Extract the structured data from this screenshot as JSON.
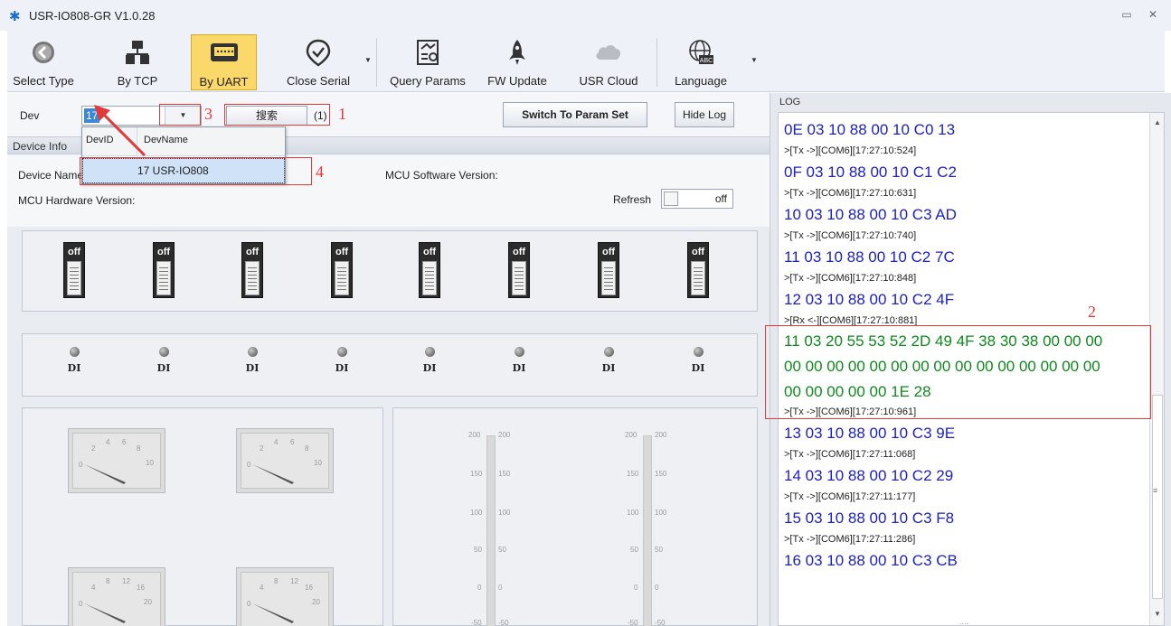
{
  "window": {
    "title": "USR-IO808-GR V1.0.28",
    "minimize": "▭",
    "close": "✕"
  },
  "toolbar": {
    "buttons": [
      {
        "label": "Select Type",
        "icon": "back-arrow-icon"
      },
      {
        "label": "By TCP",
        "icon": "network-icon"
      },
      {
        "label": "By UART",
        "icon": "serial-port-icon",
        "active": true
      },
      {
        "label": "Close Serial",
        "icon": "check-circle-icon"
      },
      {
        "label": "Query Params",
        "icon": "query-document-icon"
      },
      {
        "label": "FW Update",
        "icon": "rocket-icon"
      },
      {
        "label": "USR Cloud",
        "icon": "cloud-icon"
      },
      {
        "label": "Language",
        "icon": "globe-abc-icon"
      }
    ]
  },
  "device_bar": {
    "dev_label": "Dev",
    "dev_value": "17",
    "search_label": "搜索",
    "count": "(1)",
    "switch_label": "Switch To Param Set",
    "hide_log_label": "Hide Log"
  },
  "dropdown": {
    "col_id": "DevID",
    "col_name": "DevName",
    "row": "17 USR-IO808"
  },
  "device_info": {
    "section_title": "Device Info",
    "device_name_label": "Device Name:",
    "mcu_sw_label": "MCU Software Version:",
    "mcu_hw_label": "MCU Hardware Version:",
    "refresh_label": "Refresh",
    "refresh_state": "off"
  },
  "switches": [
    {
      "state": "off"
    },
    {
      "state": "off"
    },
    {
      "state": "off"
    },
    {
      "state": "off"
    },
    {
      "state": "off"
    },
    {
      "state": "off"
    },
    {
      "state": "off"
    },
    {
      "state": "off"
    }
  ],
  "digital_inputs": [
    {
      "label": "DI"
    },
    {
      "label": "DI"
    },
    {
      "label": "DI"
    },
    {
      "label": "DI"
    },
    {
      "label": "DI"
    },
    {
      "label": "DI"
    },
    {
      "label": "DI"
    },
    {
      "label": "DI"
    }
  ],
  "gauges": {
    "top_scale": [
      "0",
      "2",
      "4",
      "6",
      "8",
      "10"
    ],
    "bottom_scale": [
      "0",
      "4",
      "8",
      "12",
      "16",
      "20"
    ]
  },
  "scales": {
    "ticks": [
      "200",
      "150",
      "100",
      "50",
      "0",
      "-50"
    ]
  },
  "log": {
    "title": "LOG",
    "entries": [
      {
        "kind": "hex",
        "text": "0E 03 10 88 00 10 C0 13"
      },
      {
        "kind": "ts",
        "text": ">[Tx ->][COM6][17:27:10:524]"
      },
      {
        "kind": "hex",
        "text": "0F 03 10 88 00 10 C1 C2"
      },
      {
        "kind": "ts",
        "text": ">[Tx ->][COM6][17:27:10:631]"
      },
      {
        "kind": "hex",
        "text": "10 03 10 88 00 10 C3 AD"
      },
      {
        "kind": "ts",
        "text": ">[Tx ->][COM6][17:27:10:740]"
      },
      {
        "kind": "hex",
        "text": "11 03 10 88 00 10 C2 7C"
      },
      {
        "kind": "ts",
        "text": ">[Tx ->][COM6][17:27:10:848]"
      },
      {
        "kind": "hex",
        "text": "12 03 10 88 00 10 C2 4F"
      },
      {
        "kind": "ts",
        "text": ">[Rx <-][COM6][17:27:10:881]"
      },
      {
        "kind": "rx",
        "text": "11 03 20 55 53 52 2D 49 4F 38 30 38 00 00 00"
      },
      {
        "kind": "rx",
        "text": "00 00 00 00 00 00 00 00 00 00 00 00 00 00 00"
      },
      {
        "kind": "rx",
        "text": "00 00 00 00 00 1E 28"
      },
      {
        "kind": "ts",
        "text": ">[Tx ->][COM6][17:27:10:961]"
      },
      {
        "kind": "hex",
        "text": "13 03 10 88 00 10 C3 9E"
      },
      {
        "kind": "ts",
        "text": ">[Tx ->][COM6][17:27:11:068]"
      },
      {
        "kind": "hex",
        "text": "14 03 10 88 00 10 C2 29"
      },
      {
        "kind": "ts",
        "text": ">[Tx ->][COM6][17:27:11:177]"
      },
      {
        "kind": "hex",
        "text": "15 03 10 88 00 10 C3 F8"
      },
      {
        "kind": "ts",
        "text": ">[Tx ->][COM6][17:27:11:286]"
      },
      {
        "kind": "hex",
        "text": "16 03 10 88 00 10 C3 CB"
      }
    ],
    "resize_grip": "...."
  },
  "annotations": [
    "1",
    "2",
    "3",
    "4"
  ],
  "colors": {
    "accent": "#fbd86a",
    "tx_hex": "#1c20c7",
    "rx_hex": "#0e8a1c",
    "annotation": "#e03a3a"
  }
}
